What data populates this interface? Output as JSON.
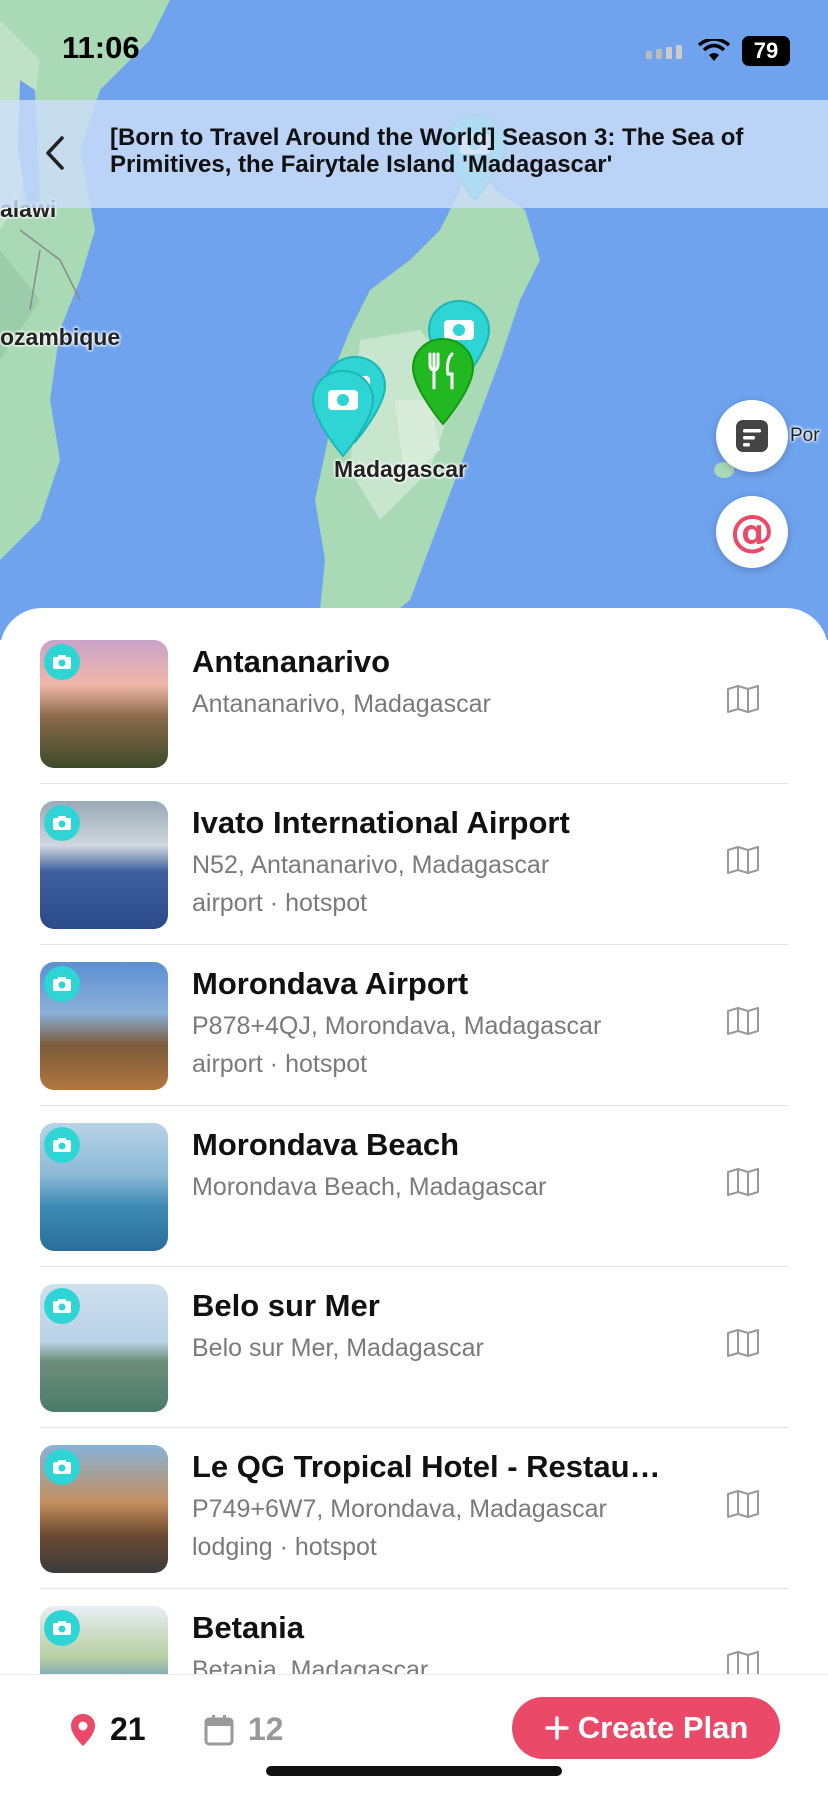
{
  "status_bar": {
    "time": "11:06",
    "battery": "79"
  },
  "header": {
    "title": "[Born to Travel Around the World] Season 3: The Sea of Primitives, the Fairytale Island 'Madagascar'"
  },
  "map": {
    "labels": {
      "malawi": "alawi",
      "mozambique": "ozambique",
      "madagascar": "Madagascar",
      "port": "Por"
    }
  },
  "places": [
    {
      "title": "Antananarivo",
      "address": "Antananarivo, Madagascar",
      "tags": ""
    },
    {
      "title": "Ivato International Airport",
      "address": "N52, Antananarivo, Madagascar",
      "tags": "airport · hotspot"
    },
    {
      "title": "Morondava Airport",
      "address": "P878+4QJ, Morondava, Madagascar",
      "tags": "airport · hotspot"
    },
    {
      "title": "Morondava Beach",
      "address": "Morondava Beach, Madagascar",
      "tags": ""
    },
    {
      "title": "Belo sur Mer",
      "address": "Belo sur Mer, Madagascar",
      "tags": ""
    },
    {
      "title": "Le QG Tropical Hotel - Restau…",
      "address": "P749+6W7, Morondava, Madagascar",
      "tags": "lodging · hotspot"
    },
    {
      "title": "Betania",
      "address": "Betania, Madagascar",
      "tags": ""
    }
  ],
  "bottom_bar": {
    "places_count": "21",
    "days_count": "12",
    "create_label": "Create Plan"
  },
  "colors": {
    "accent": "#ea4a68",
    "camera_pin": "#2fd4d4",
    "food_pin": "#22b822",
    "water": "#6fa3ee",
    "land": "#a9d9b5"
  },
  "icons": [
    "back-icon",
    "camera-icon",
    "fork-knife-icon",
    "notes-icon",
    "at-icon",
    "map-icon",
    "location-pin-icon",
    "calendar-icon",
    "plus-icon"
  ]
}
